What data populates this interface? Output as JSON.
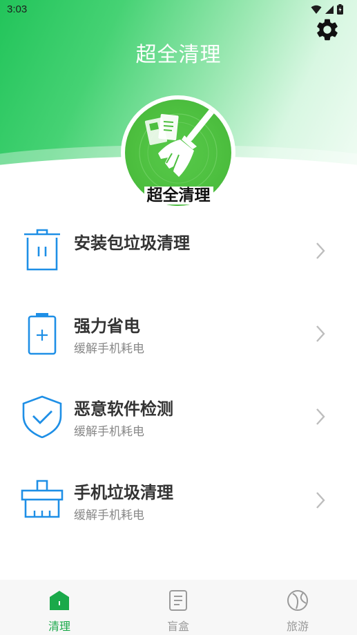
{
  "status_bar": {
    "time": "3:03"
  },
  "header": {
    "title": "超全清理",
    "logo_label": "超全清理"
  },
  "menu": [
    {
      "title": "安装包垃圾清理",
      "subtitle": "",
      "icon": "trash-bin-icon"
    },
    {
      "title": "强力省电",
      "subtitle": "缓解手机耗电",
      "icon": "battery-icon"
    },
    {
      "title": "恶意软件检测",
      "subtitle": "缓解手机耗电",
      "icon": "shield-check-icon"
    },
    {
      "title": "手机垃圾清理",
      "subtitle": "缓解手机耗电",
      "icon": "brush-icon"
    }
  ],
  "bottom_nav": [
    {
      "label": "清理",
      "icon": "home-icon",
      "active": true
    },
    {
      "label": "盲盒",
      "icon": "document-icon",
      "active": false
    },
    {
      "label": "旅游",
      "icon": "ball-icon",
      "active": false
    }
  ],
  "colors": {
    "accent_blue": "#1e8fe6",
    "active_green": "#1aa94a",
    "inactive_gray": "#9a9a9a"
  }
}
